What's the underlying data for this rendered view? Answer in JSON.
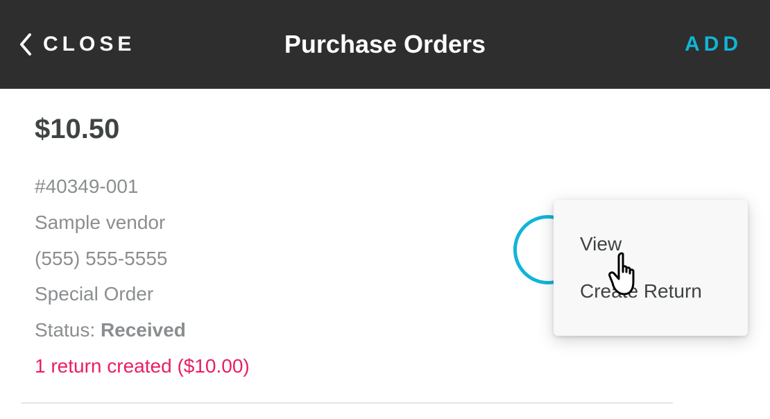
{
  "header": {
    "close_label": "CLOSE",
    "title": "Purchase Orders",
    "add_label": "ADD"
  },
  "order": {
    "amount": "$10.50",
    "id": "#40349-001",
    "vendor": "Sample vendor",
    "phone": "(555) 555-5555",
    "type": "Special Order",
    "status_label": "Status: ",
    "status_value": "Received",
    "return_text": "1 return created ($10.00)"
  },
  "popup": {
    "view": "View",
    "create_return": "Create Return"
  }
}
